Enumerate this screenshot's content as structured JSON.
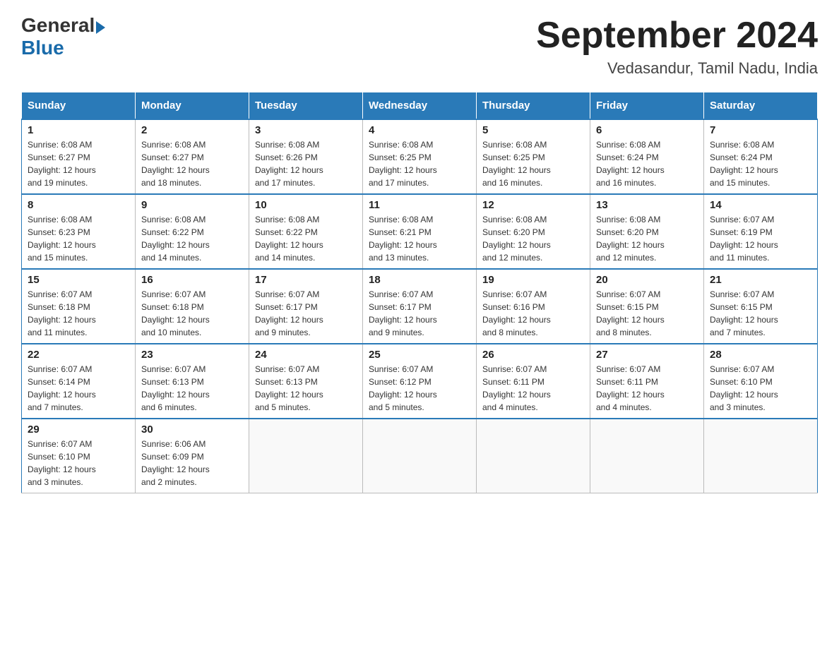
{
  "header": {
    "logo_general": "General",
    "logo_blue": "Blue",
    "title": "September 2024",
    "subtitle": "Vedasandur, Tamil Nadu, India"
  },
  "weekdays": [
    "Sunday",
    "Monday",
    "Tuesday",
    "Wednesday",
    "Thursday",
    "Friday",
    "Saturday"
  ],
  "weeks": [
    [
      {
        "day": "1",
        "sunrise": "6:08 AM",
        "sunset": "6:27 PM",
        "daylight": "12 hours and 19 minutes."
      },
      {
        "day": "2",
        "sunrise": "6:08 AM",
        "sunset": "6:27 PM",
        "daylight": "12 hours and 18 minutes."
      },
      {
        "day": "3",
        "sunrise": "6:08 AM",
        "sunset": "6:26 PM",
        "daylight": "12 hours and 17 minutes."
      },
      {
        "day": "4",
        "sunrise": "6:08 AM",
        "sunset": "6:25 PM",
        "daylight": "12 hours and 17 minutes."
      },
      {
        "day": "5",
        "sunrise": "6:08 AM",
        "sunset": "6:25 PM",
        "daylight": "12 hours and 16 minutes."
      },
      {
        "day": "6",
        "sunrise": "6:08 AM",
        "sunset": "6:24 PM",
        "daylight": "12 hours and 16 minutes."
      },
      {
        "day": "7",
        "sunrise": "6:08 AM",
        "sunset": "6:24 PM",
        "daylight": "12 hours and 15 minutes."
      }
    ],
    [
      {
        "day": "8",
        "sunrise": "6:08 AM",
        "sunset": "6:23 PM",
        "daylight": "12 hours and 15 minutes."
      },
      {
        "day": "9",
        "sunrise": "6:08 AM",
        "sunset": "6:22 PM",
        "daylight": "12 hours and 14 minutes."
      },
      {
        "day": "10",
        "sunrise": "6:08 AM",
        "sunset": "6:22 PM",
        "daylight": "12 hours and 14 minutes."
      },
      {
        "day": "11",
        "sunrise": "6:08 AM",
        "sunset": "6:21 PM",
        "daylight": "12 hours and 13 minutes."
      },
      {
        "day": "12",
        "sunrise": "6:08 AM",
        "sunset": "6:20 PM",
        "daylight": "12 hours and 12 minutes."
      },
      {
        "day": "13",
        "sunrise": "6:08 AM",
        "sunset": "6:20 PM",
        "daylight": "12 hours and 12 minutes."
      },
      {
        "day": "14",
        "sunrise": "6:07 AM",
        "sunset": "6:19 PM",
        "daylight": "12 hours and 11 minutes."
      }
    ],
    [
      {
        "day": "15",
        "sunrise": "6:07 AM",
        "sunset": "6:18 PM",
        "daylight": "12 hours and 11 minutes."
      },
      {
        "day": "16",
        "sunrise": "6:07 AM",
        "sunset": "6:18 PM",
        "daylight": "12 hours and 10 minutes."
      },
      {
        "day": "17",
        "sunrise": "6:07 AM",
        "sunset": "6:17 PM",
        "daylight": "12 hours and 9 minutes."
      },
      {
        "day": "18",
        "sunrise": "6:07 AM",
        "sunset": "6:17 PM",
        "daylight": "12 hours and 9 minutes."
      },
      {
        "day": "19",
        "sunrise": "6:07 AM",
        "sunset": "6:16 PM",
        "daylight": "12 hours and 8 minutes."
      },
      {
        "day": "20",
        "sunrise": "6:07 AM",
        "sunset": "6:15 PM",
        "daylight": "12 hours and 8 minutes."
      },
      {
        "day": "21",
        "sunrise": "6:07 AM",
        "sunset": "6:15 PM",
        "daylight": "12 hours and 7 minutes."
      }
    ],
    [
      {
        "day": "22",
        "sunrise": "6:07 AM",
        "sunset": "6:14 PM",
        "daylight": "12 hours and 7 minutes."
      },
      {
        "day": "23",
        "sunrise": "6:07 AM",
        "sunset": "6:13 PM",
        "daylight": "12 hours and 6 minutes."
      },
      {
        "day": "24",
        "sunrise": "6:07 AM",
        "sunset": "6:13 PM",
        "daylight": "12 hours and 5 minutes."
      },
      {
        "day": "25",
        "sunrise": "6:07 AM",
        "sunset": "6:12 PM",
        "daylight": "12 hours and 5 minutes."
      },
      {
        "day": "26",
        "sunrise": "6:07 AM",
        "sunset": "6:11 PM",
        "daylight": "12 hours and 4 minutes."
      },
      {
        "day": "27",
        "sunrise": "6:07 AM",
        "sunset": "6:11 PM",
        "daylight": "12 hours and 4 minutes."
      },
      {
        "day": "28",
        "sunrise": "6:07 AM",
        "sunset": "6:10 PM",
        "daylight": "12 hours and 3 minutes."
      }
    ],
    [
      {
        "day": "29",
        "sunrise": "6:07 AM",
        "sunset": "6:10 PM",
        "daylight": "12 hours and 3 minutes."
      },
      {
        "day": "30",
        "sunrise": "6:06 AM",
        "sunset": "6:09 PM",
        "daylight": "12 hours and 2 minutes."
      },
      null,
      null,
      null,
      null,
      null
    ]
  ]
}
